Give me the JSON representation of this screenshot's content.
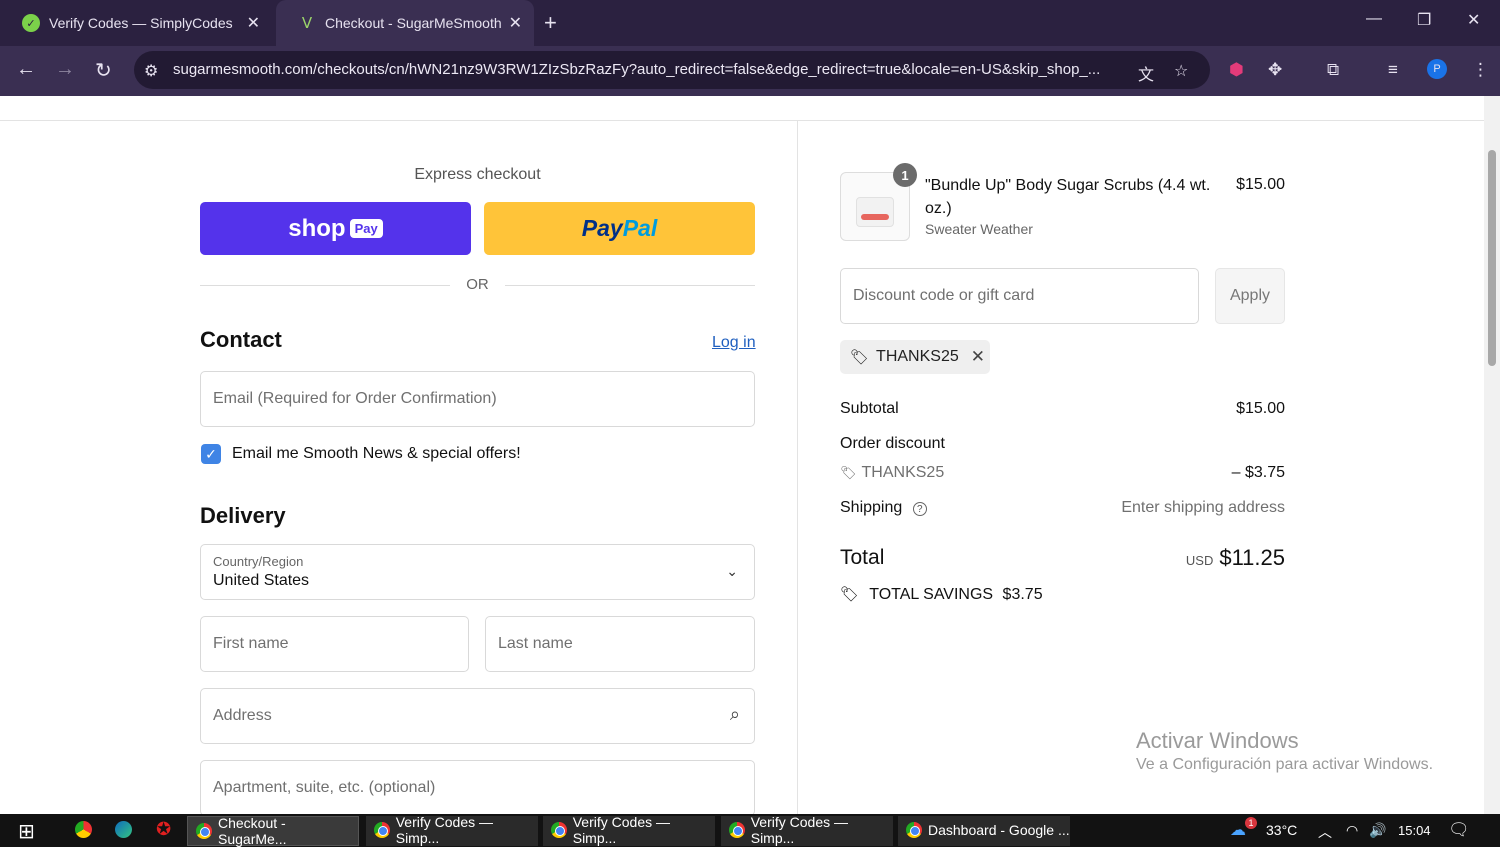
{
  "browser": {
    "tabs": [
      {
        "title": "Verify Codes — SimplyCodes",
        "active": false
      },
      {
        "title": "Checkout - SugarMeSmooth",
        "active": true
      }
    ],
    "url": "sugarmesmooth.com/checkouts/cn/hWN21nz9W3RW1ZIzSbzRazFy?auto_redirect=false&edge_redirect=true&locale=en-US&skip_shop_...",
    "profile_initial": "P"
  },
  "checkout": {
    "express_label": "Express checkout",
    "shoppay_label": "shop",
    "shoppay_badge": "Pay",
    "paypal_label_1": "Pay",
    "paypal_label_2": "Pal",
    "or_label": "OR",
    "contact_heading": "Contact",
    "login_label": "Log in",
    "email_placeholder": "Email (Required for Order Confirmation)",
    "newsletter_label": "Email me Smooth News & special offers!",
    "delivery_heading": "Delivery",
    "country_label": "Country/Region",
    "country_value": "United States",
    "first_name_placeholder": "First name",
    "last_name_placeholder": "Last name",
    "address_placeholder": "Address",
    "apartment_placeholder": "Apartment, suite, etc. (optional)"
  },
  "summary": {
    "item": {
      "quantity": "1",
      "name": "\"Bundle Up\" Body Sugar Scrubs (4.4 wt. oz.)",
      "variant": "Sweater Weather",
      "price": "$15.00"
    },
    "discount_placeholder": "Discount code or gift card",
    "apply_label": "Apply",
    "applied_code": "THANKS25",
    "subtotal_label": "Subtotal",
    "subtotal_value": "$15.00",
    "order_discount_label": "Order discount",
    "discount_code": "THANKS25",
    "discount_value": "– $3.75",
    "shipping_label": "Shipping",
    "shipping_value": "Enter shipping address",
    "total_label": "Total",
    "total_currency": "USD",
    "total_value": "$11.25",
    "savings_label": "TOTAL SAVINGS",
    "savings_value": "$3.75"
  },
  "watermark": {
    "line1": "Activar Windows",
    "line2": "Ve a Configuración para activar Windows."
  },
  "taskbar": {
    "apps": [
      {
        "title": "Checkout - SugarMe...",
        "active": true
      },
      {
        "title": "Verify Codes — Simp...",
        "active": false
      },
      {
        "title": "Verify Codes — Simp...",
        "active": false
      },
      {
        "title": "Verify Codes — Simp...",
        "active": false
      },
      {
        "title": "Dashboard - Google ...",
        "active": false
      }
    ],
    "weather_badge": "1",
    "temperature": "33°C",
    "time": "15:04"
  },
  "colors": {
    "shoppay": "#5433eb",
    "paypal": "#ffc439",
    "link": "#1f5fbf",
    "checkbox": "#3f84e5"
  }
}
